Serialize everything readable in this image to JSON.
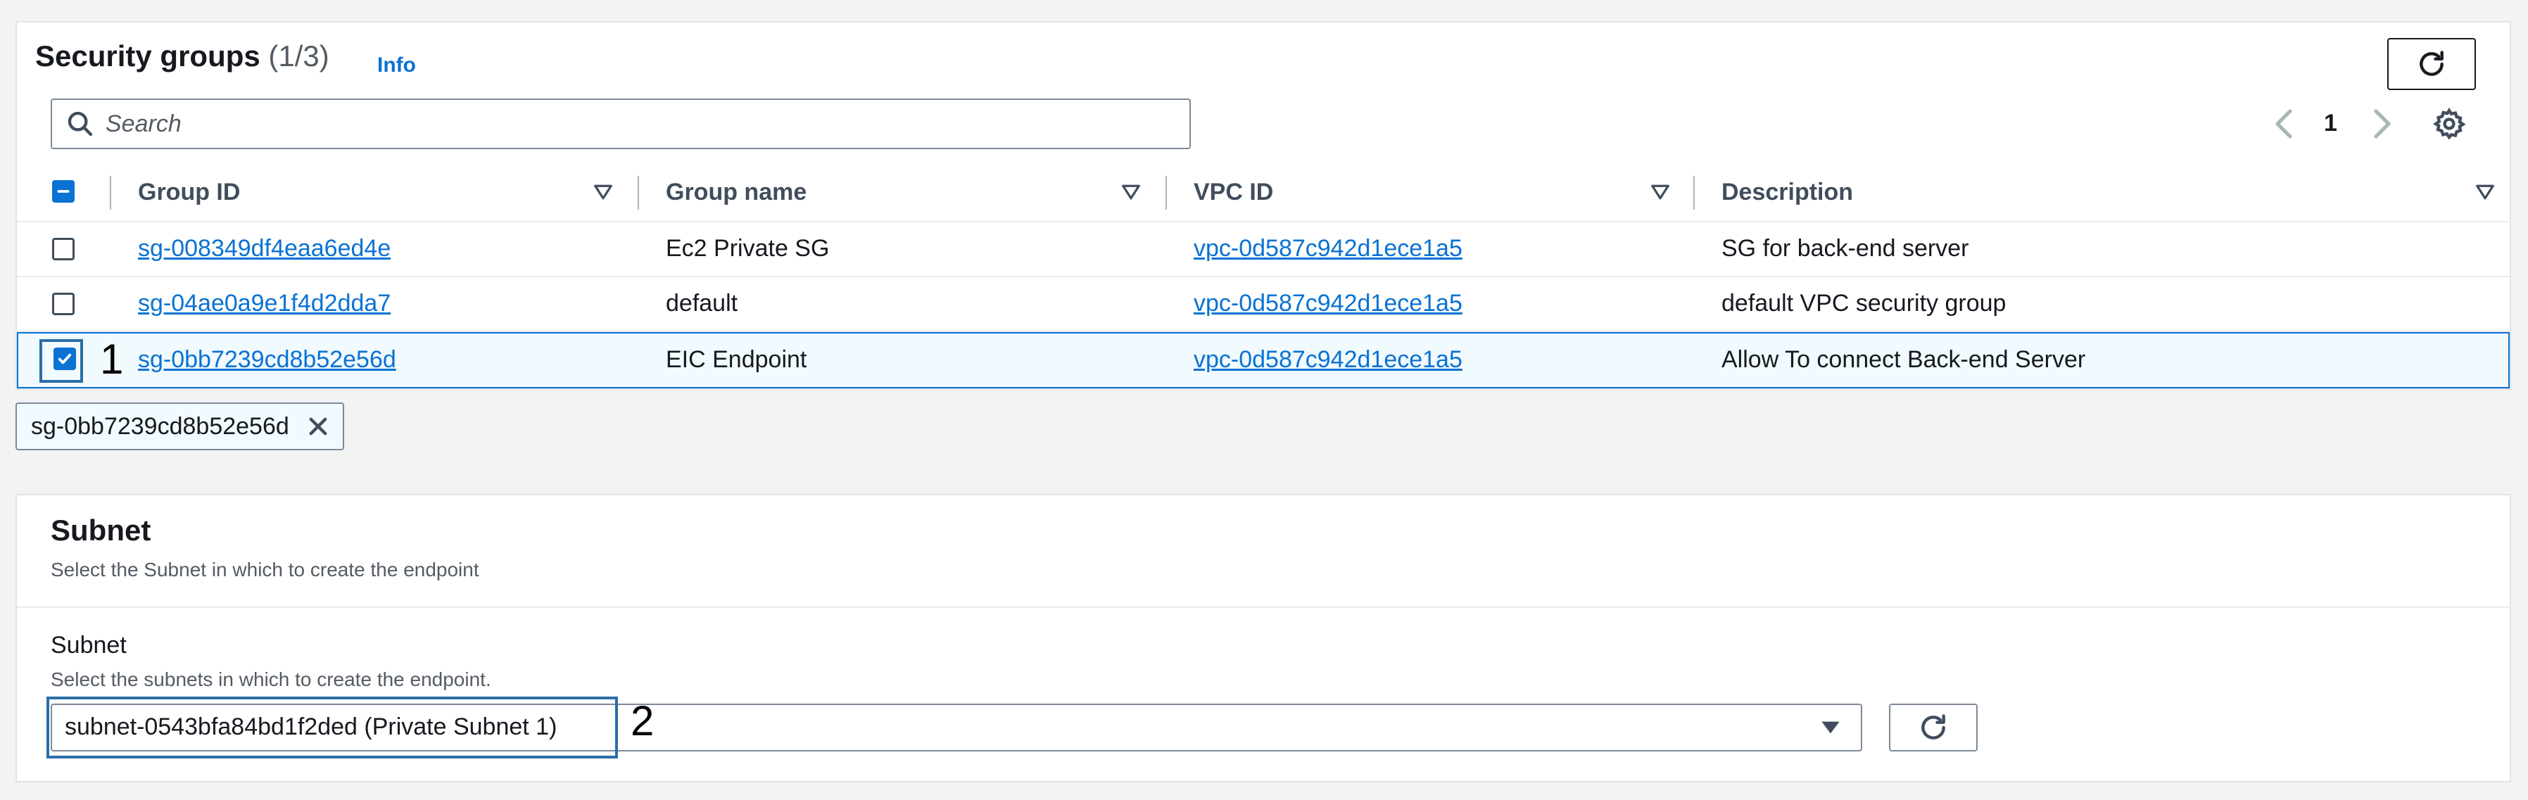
{
  "security_groups": {
    "title": "Security groups",
    "count": "(1/3)",
    "info_label": "Info",
    "search_placeholder": "Search",
    "page_number": "1",
    "columns": [
      "Group ID",
      "Group name",
      "VPC ID",
      "Description"
    ],
    "rows": [
      {
        "group_id": "sg-008349df4eaa6ed4e",
        "group_name": "Ec2 Private SG",
        "vpc_id": "vpc-0d587c942d1ece1a5",
        "description": "SG for back-end server",
        "selected": false
      },
      {
        "group_id": "sg-04ae0a9e1f4d2dda7",
        "group_name": "default",
        "vpc_id": "vpc-0d587c942d1ece1a5",
        "description": "default VPC security group",
        "selected": false
      },
      {
        "group_id": "sg-0bb7239cd8b52e56d",
        "group_name": "EIC Endpoint",
        "vpc_id": "vpc-0d587c942d1ece1a5",
        "description": "Allow To connect Back-end Server",
        "selected": true
      }
    ],
    "selected_token": "sg-0bb7239cd8b52e56d",
    "annotation_1": "1"
  },
  "subnet": {
    "section_title": "Subnet",
    "section_description": "Select the Subnet in which to create the endpoint",
    "field_label": "Subnet",
    "field_description": "Select the subnets in which to create the endpoint.",
    "selected_value": "subnet-0543bfa84bd1f2ded (Private Subnet 1)",
    "annotation_2": "2"
  },
  "colors": {
    "link": "#0972d3",
    "selected_row_bg": "#f1faff",
    "highlight_border": "#2b6ea8"
  },
  "icons": [
    "refresh-icon",
    "search-icon",
    "chevron-left-icon",
    "chevron-right-icon",
    "settings-icon",
    "sort-caret-icon",
    "checkmark-icon",
    "close-icon",
    "caret-down-icon"
  ]
}
